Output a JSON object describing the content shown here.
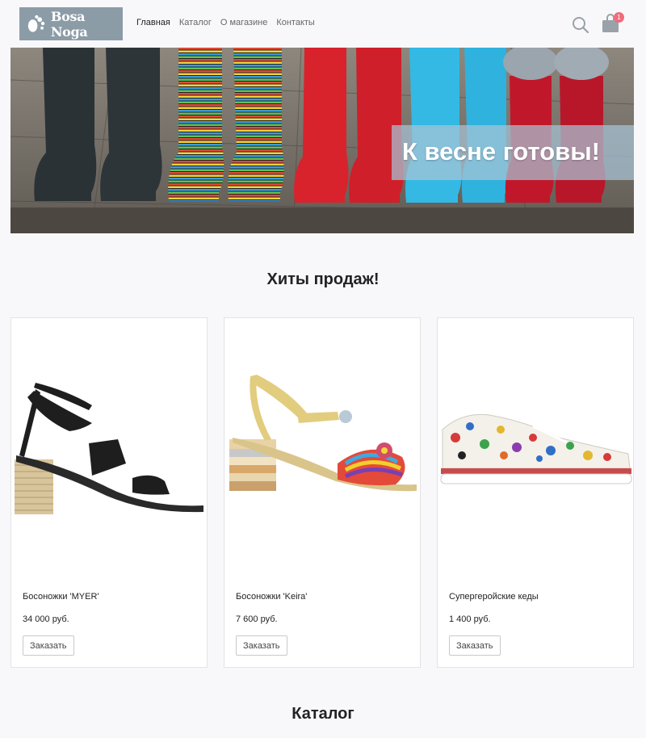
{
  "header": {
    "logo_text": "Bosa Noga",
    "nav": [
      {
        "label": "Главная",
        "active": true
      },
      {
        "label": "Каталог",
        "active": false
      },
      {
        "label": "О магазине",
        "active": false
      },
      {
        "label": "Контакты",
        "active": false
      }
    ],
    "cart_count": "1",
    "icons": {
      "search": "search-icon",
      "cart": "shopping-bag-icon"
    }
  },
  "hero": {
    "title": "К весне готовы!"
  },
  "sections": {
    "top_sales_title": "Хиты продаж!",
    "catalog_title": "Каталог"
  },
  "products": [
    {
      "name": "Босоножки 'MYER'",
      "price": "34 000 руб.",
      "button": "Заказать"
    },
    {
      "name": "Босоножки 'Keira'",
      "price": "7 600 руб.",
      "button": "Заказать"
    },
    {
      "name": "Супергеройские кеды",
      "price": "1 400 руб.",
      "button": "Заказать"
    }
  ],
  "colors": {
    "logo_bg": "#8c9ca7",
    "badge": "#f16b7c",
    "page_bg": "#f8f8fa"
  }
}
